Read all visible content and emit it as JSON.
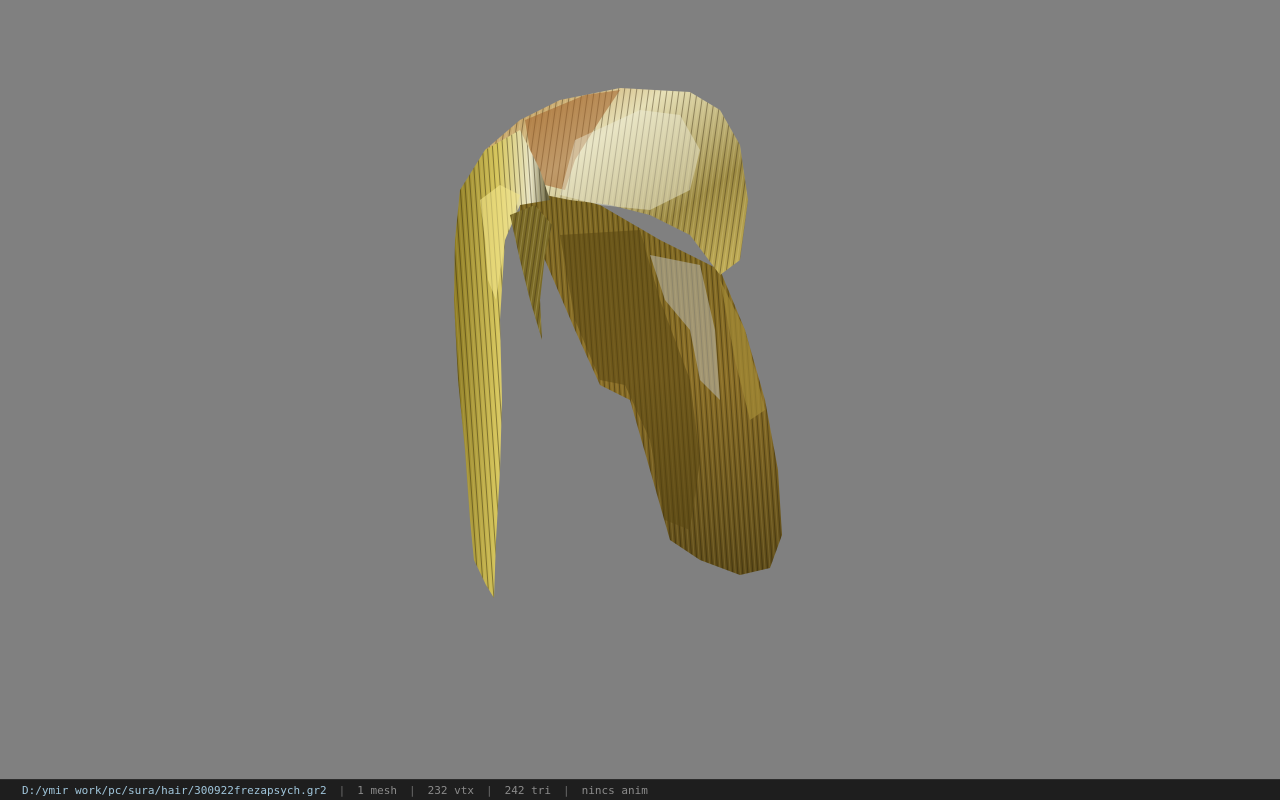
{
  "status_bar": {
    "file_path": "D:/ymir work/pc/sura/hair/300922frezapsych.gr2",
    "separator": "|",
    "mesh_count": "1 mesh",
    "vertex_count": "232 vtx",
    "triangle_count": "242 tri",
    "animation": "nincs anim"
  },
  "viewport": {
    "background_color": "#808080",
    "model": "hair-mesh"
  }
}
